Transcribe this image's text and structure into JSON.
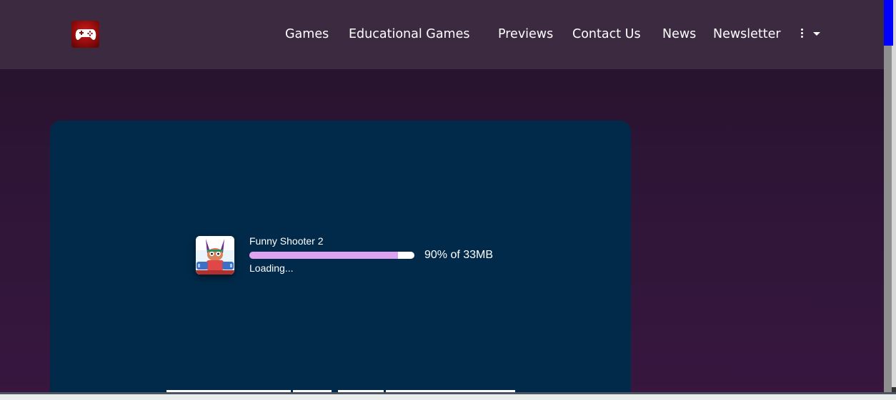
{
  "header": {
    "logo_icon": "gamepad-logo-icon",
    "nav": [
      {
        "label": "Games"
      },
      {
        "label": "Educational Games"
      },
      {
        "label": "Previews"
      },
      {
        "label": "Contact Us"
      },
      {
        "label": "News"
      },
      {
        "label": "Newsletter"
      }
    ],
    "more_icon": "kebab-dropdown-icon"
  },
  "loader": {
    "game_title": "Funny Shooter 2",
    "progress_percent": 90,
    "progress_text": "90% of 33MB",
    "status": "Loading...",
    "colors": {
      "panel": "#012a4a",
      "progress_fill": "#dea2f0",
      "progress_track": "#ffffff"
    }
  },
  "colors": {
    "header_bg": "#3c2a40",
    "page_bg": "#2d1536",
    "scroll_thumb": "#0000ff"
  }
}
